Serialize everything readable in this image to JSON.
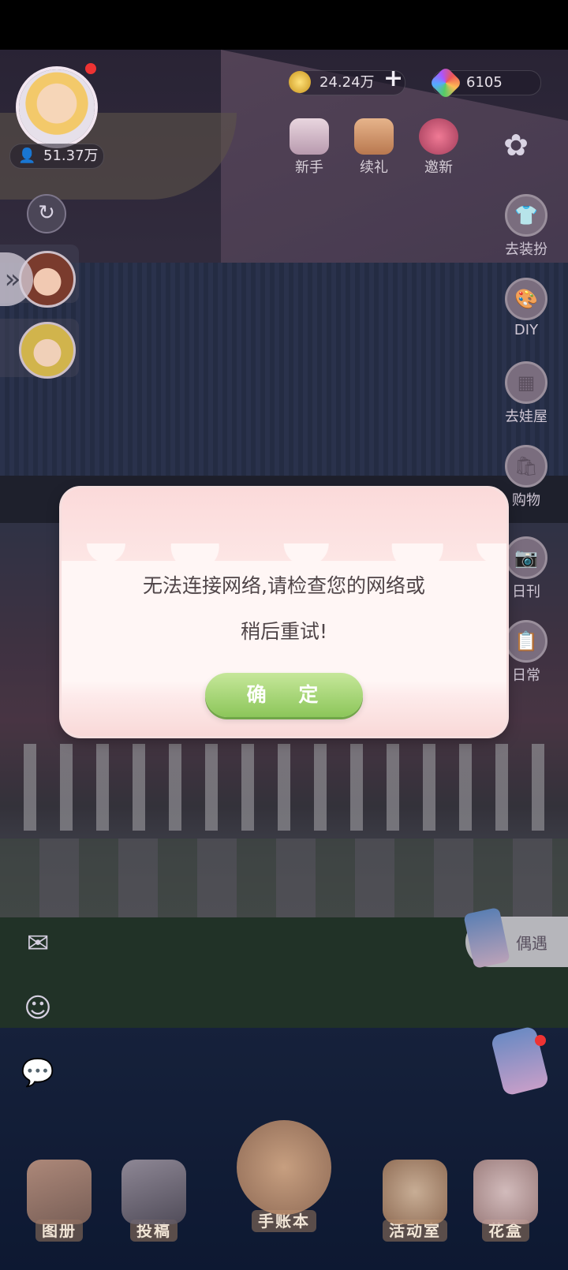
{
  "player": {
    "gold": "24.24万",
    "gems": "6105",
    "popularity": "51.37万"
  },
  "top_icons": [
    {
      "label": "新手",
      "icon": "newbie-gift-icon"
    },
    {
      "label": "续礼",
      "icon": "renewal-gift-icon"
    },
    {
      "label": "邀新",
      "icon": "invite-heart-icon"
    }
  ],
  "side_icons": [
    {
      "label": "去装扮",
      "icon": "dress-up-icon"
    },
    {
      "label": "DIY",
      "icon": "palette-icon"
    },
    {
      "label": "去娃屋",
      "icon": "doll-house-icon"
    },
    {
      "label": "购物",
      "icon": "shopping-bag-icon"
    },
    {
      "label": "日刊",
      "icon": "camera-icon"
    },
    {
      "label": "日常",
      "icon": "clipboard-icon"
    }
  ],
  "encounter_label": "偶遇",
  "bottom_nav": [
    {
      "label": "图册"
    },
    {
      "label": "投稿"
    },
    {
      "label": "手账本"
    },
    {
      "label": "活动室"
    },
    {
      "label": "花盒"
    }
  ],
  "dialog": {
    "message_line1": "无法连接网络,请检查您的网络或",
    "message_line2": "稍后重试!",
    "confirm": "确 定"
  },
  "colors": {
    "confirm_button": "#8cc65a",
    "dialog_bg": "#fff6f5",
    "red_dot": "#e33333"
  }
}
